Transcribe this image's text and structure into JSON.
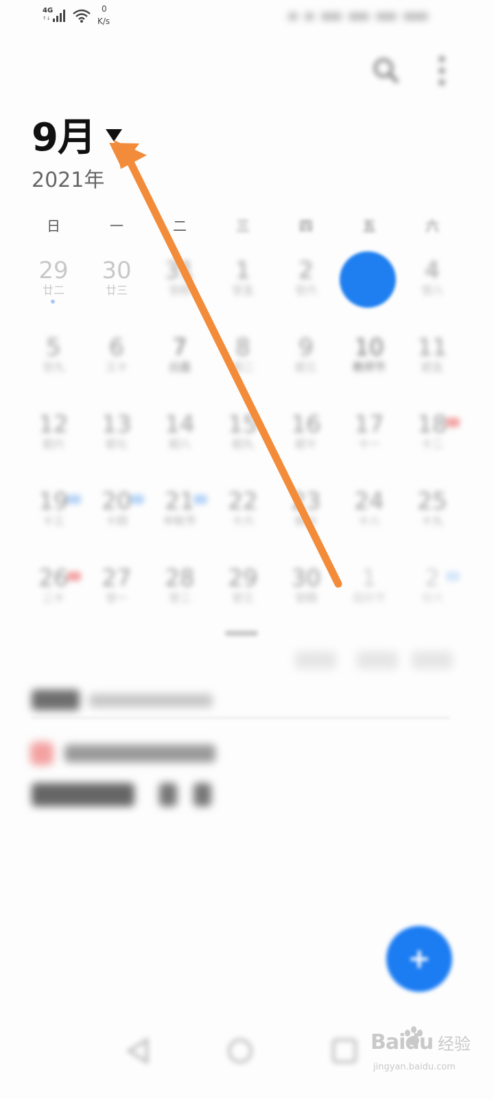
{
  "status_bar": {
    "network_type": "4G",
    "network_sub": "↑↓",
    "speed_value": "0",
    "speed_unit": "K/s",
    "icons": [
      "signal-icon",
      "wifi-icon"
    ]
  },
  "header": {
    "month": "9月",
    "year": "2021年",
    "icons": [
      "dropdown-triangle-icon",
      "search-icon",
      "more-vertical-icon"
    ]
  },
  "weekdays": [
    "日",
    "一",
    "二",
    "三",
    "四",
    "五",
    "六"
  ],
  "calendar_visible_cells": [
    {
      "day": "29",
      "lunar": "廿二"
    },
    {
      "day": "30",
      "lunar": "廿三"
    }
  ],
  "colors": {
    "accent_blue": "#1f7ff0",
    "annotation_orange": "#f28c3a",
    "title_text": "#111111",
    "muted_text": "#666666"
  },
  "fab": {
    "label": "+"
  },
  "watermark": {
    "logo": "Baidu",
    "cn": "经验",
    "url": "jingyan.baidu.com"
  }
}
